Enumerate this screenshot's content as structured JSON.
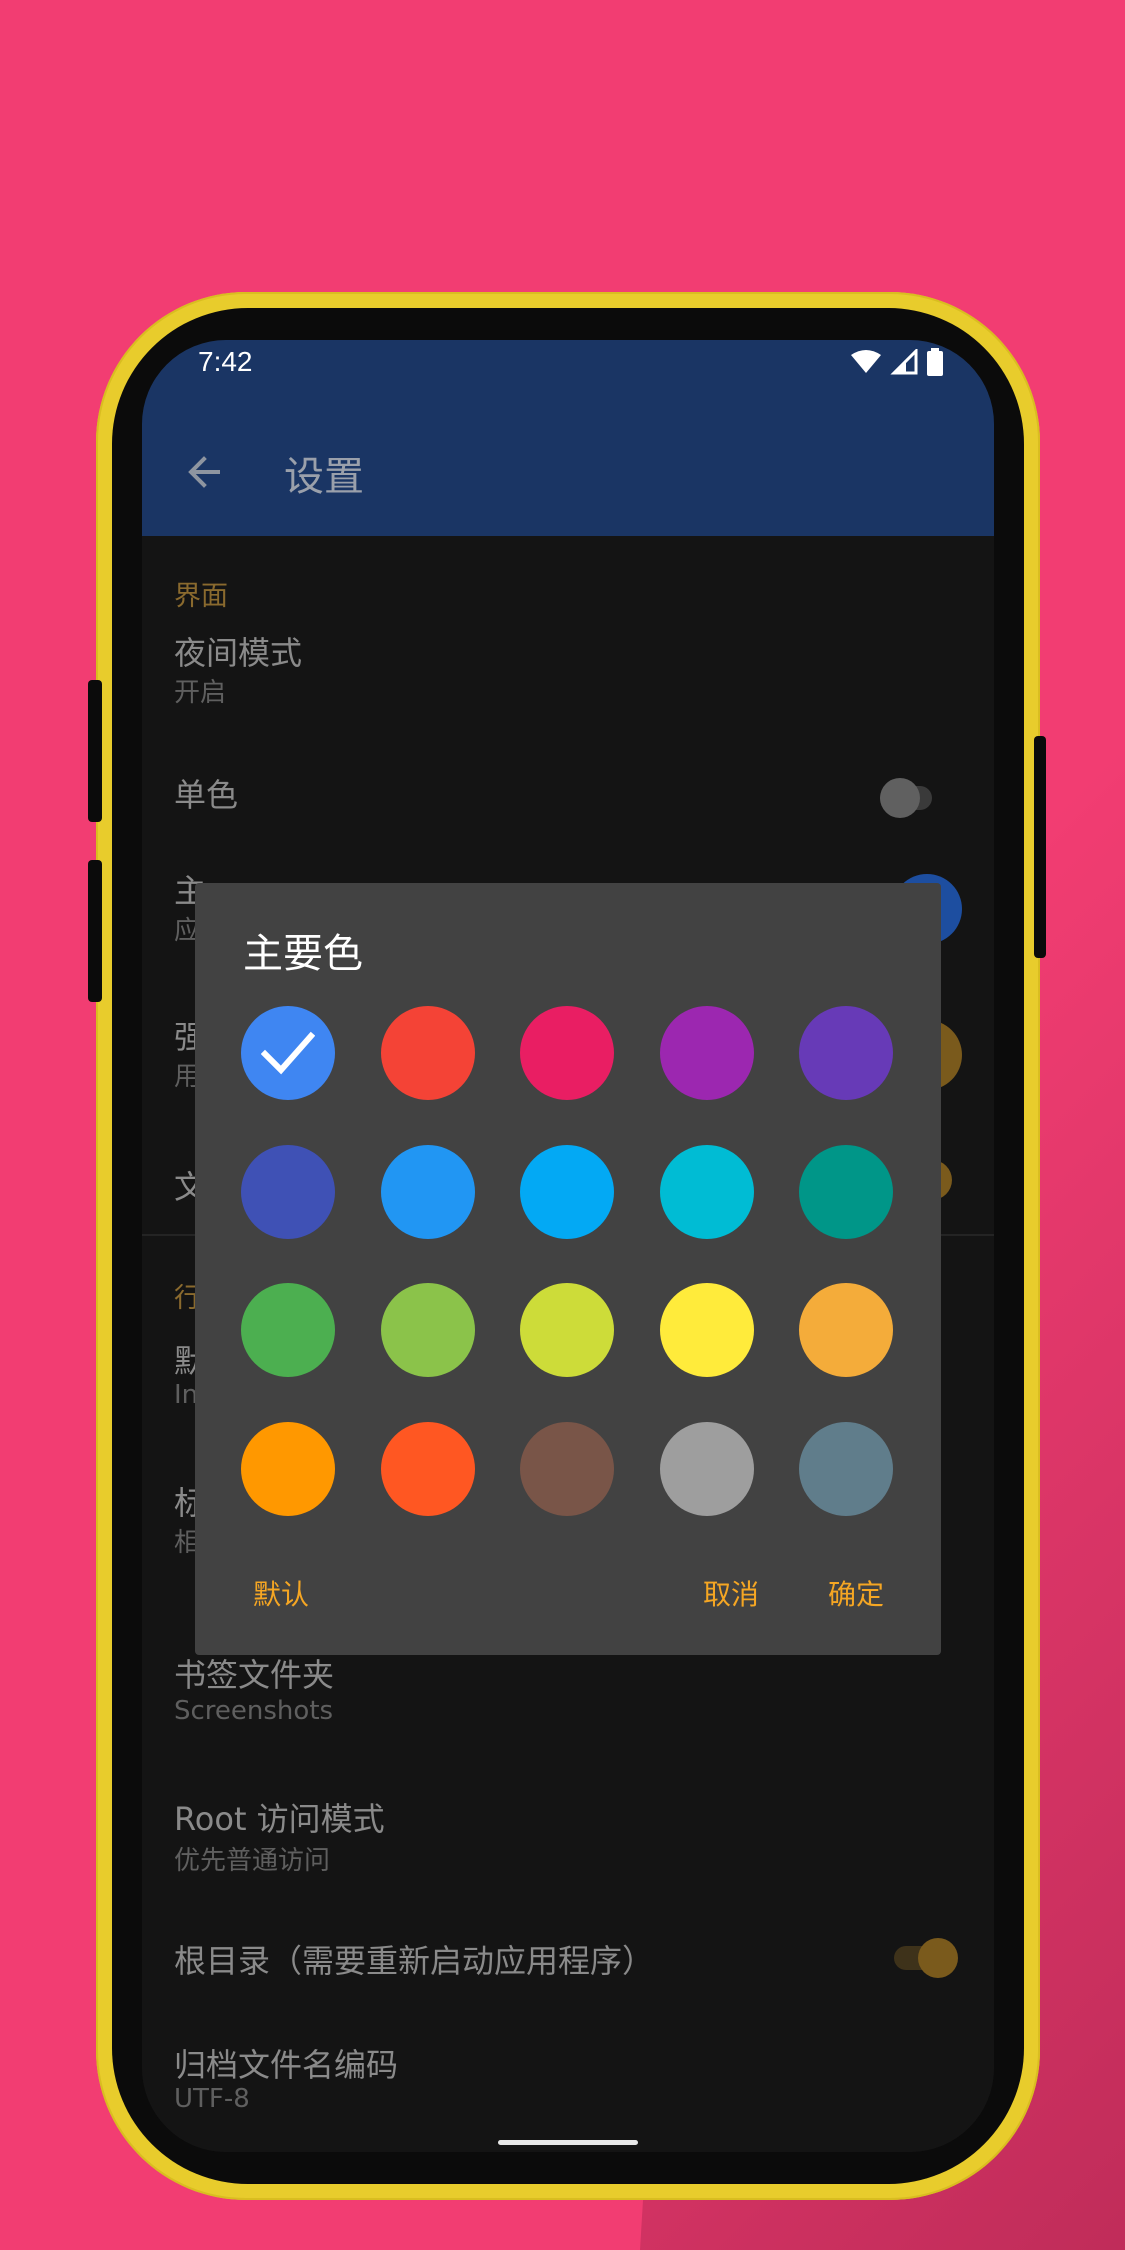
{
  "status_bar": {
    "time": "7:42"
  },
  "app_bar": {
    "title": "设置"
  },
  "settings": {
    "section_interface": "界面",
    "night_mode": {
      "title": "夜间模式",
      "subtitle": "开启"
    },
    "monochrome": {
      "title": "单色"
    },
    "primary_color": {
      "title": "主",
      "subtitle": "应"
    },
    "accent_color": {
      "title": "强",
      "subtitle": "用"
    },
    "text_item": {
      "title": "文"
    },
    "section_behavior": "行",
    "default_item": {
      "title": "默",
      "subtitle": "In"
    },
    "tab_item": {
      "title": "标",
      "subtitle": "相"
    },
    "bookmark_folder": {
      "title": "书签文件夹",
      "subtitle": "Screenshots"
    },
    "root_access": {
      "title": "Root 访问模式",
      "subtitle": "优先普通访问"
    },
    "root_directory": {
      "title": "根目录（需要重新启动应用程序）"
    },
    "archive_encoding": {
      "title": "归档文件名编码",
      "subtitle": "UTF-8"
    }
  },
  "dialog": {
    "title": "主要色",
    "selected_index": 0,
    "colors": [
      "#3f86f2",
      "#f44336",
      "#e91e63",
      "#9c27b0",
      "#673ab7",
      "#3f51b5",
      "#2196f3",
      "#03a9f4",
      "#00bcd4",
      "#009688",
      "#4caf50",
      "#8bc34a",
      "#cddc39",
      "#ffeb3b",
      "#f4ac3a",
      "#ff9800",
      "#ff5722",
      "#795548",
      "#9e9e9e",
      "#607d8b"
    ],
    "buttons": {
      "default": "默认",
      "cancel": "取消",
      "ok": "确定"
    }
  },
  "colors": {
    "background": "#f23d72",
    "phone_frame": "#e8cc2c",
    "app_bar": "#1a3564",
    "accent": "#f5a623"
  }
}
